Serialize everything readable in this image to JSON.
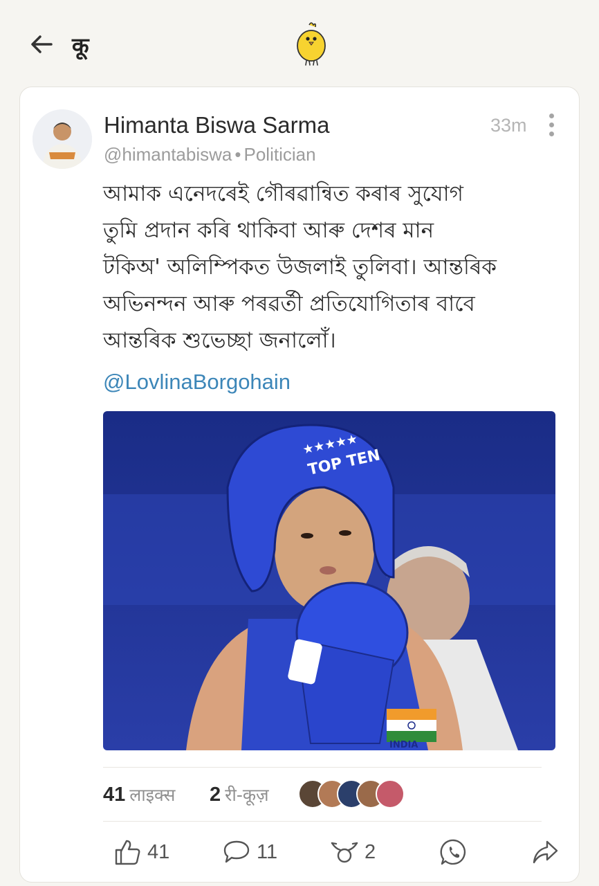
{
  "header": {
    "title": "कू",
    "back_icon": "back-arrow-icon",
    "logo_icon": "koo-bird-logo"
  },
  "post": {
    "author_name": "Himanta Biswa Sarma",
    "handle": "@himantabiswa",
    "separator": "•",
    "role": "Politician",
    "time": "33m",
    "text": "আমাক এনেদৰেই গৌৰৱান্বিত কৰাৰ সুযোগ\nতুমি প্ৰদান কৰি থাকিবা আৰু দেশৰ মান\nটকিঅ' অলিম্পিকত উজলাই তুলিবা। আন্তৰিক\nঅভিনন্দন আৰু পৰৱৰ্তী প্ৰতিযোগিতাৰ বাবে\nআন্তৰিক শুভেচ্ছা জনালোঁ।",
    "mention": "@LovlinaBorgohain",
    "image_texts": [
      "TOP TEN",
      "INDIA"
    ]
  },
  "stats": {
    "likes_count": "41",
    "likes_label": "लाइक्स",
    "rekoos_count": "2",
    "rekoos_label": "री-कूज़"
  },
  "actions": {
    "like_count": "41",
    "comment_count": "11",
    "rekoo_count": "2"
  },
  "colors": {
    "background": "#f6f5f1",
    "mention": "#3c86b8",
    "logo_yellow": "#f7d330"
  }
}
